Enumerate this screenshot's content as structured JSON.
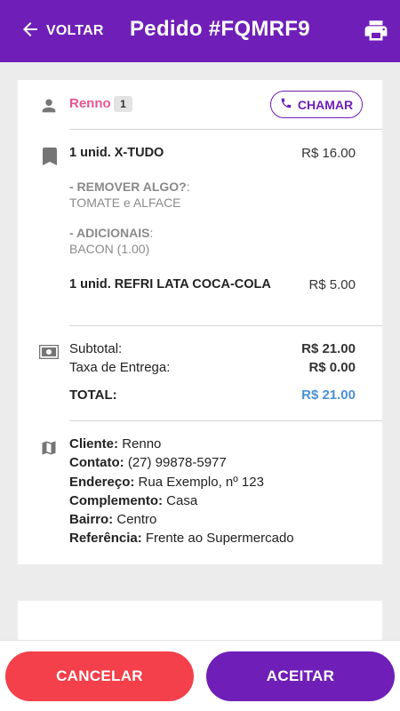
{
  "header": {
    "back_label": "VOLTAR",
    "title": "Pedido #FQMRF9",
    "print_icon": "printer-icon",
    "back_icon": "arrow-left-icon"
  },
  "customer": {
    "name": "Renno",
    "order_count": "1",
    "call_label": "CHAMAR",
    "icon": "person-icon"
  },
  "items": [
    {
      "name": "1 unid. X-TUDO",
      "price": "R$ 16.00",
      "remove_label": "- REMOVER ALGO?",
      "remove_suffix": ":",
      "remove_value": "TOMATE e ALFACE",
      "add_label": "- ADICIONAIS",
      "add_suffix": ":",
      "add_value": "BACON (1.00)"
    },
    {
      "name": "1 unid. REFRI LATA COCA-COLA",
      "price": "R$ 5.00"
    }
  ],
  "totals": {
    "subtotal_label": "Subtotal:",
    "subtotal_value": "R$ 21.00",
    "delivery_label": "Taxa de Entrega:",
    "delivery_value": "R$ 0.00",
    "total_label": "TOTAL:",
    "total_value": "R$ 21.00",
    "icon": "money-icon"
  },
  "delivery": {
    "icon": "map-icon",
    "client_label": "Cliente:",
    "client_value": "Renno",
    "contact_label": "Contato:",
    "contact_value": "(27) 99878-5977",
    "address_label": "Endereço:",
    "address_value": "Rua Exemplo, nº 123",
    "complement_label": "Complemento:",
    "complement_value": "Casa",
    "district_label": "Bairro:",
    "district_value": "Centro",
    "reference_label": "Referência:",
    "reference_value": "Frente ao Supermercado"
  },
  "actions": {
    "cancel_label": "CANCELAR",
    "accept_label": "ACEITAR"
  },
  "colors": {
    "primary": "#6f1fb8",
    "danger": "#f4404a",
    "customer_name": "#e8568f",
    "total_value": "#4a90d9"
  }
}
